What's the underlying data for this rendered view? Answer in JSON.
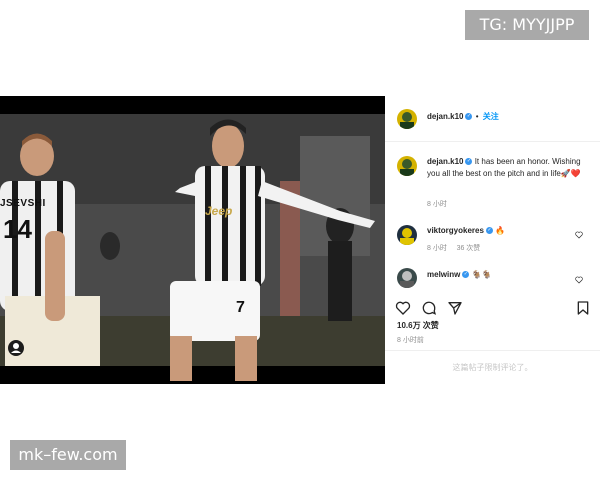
{
  "watermarks": {
    "top": "TG: MYYJJPP",
    "bottom": "mk–few.com"
  },
  "post": {
    "author": "dejan.k10",
    "follow_label": "关注",
    "separator": "•",
    "caption_user": "dejan.k10",
    "caption_text": "It has been an honor. Wishing you all the best on the pitch and in life🚀❤️",
    "caption_time": "8 小时",
    "likes": "10.6万 次赞",
    "timestamp": "8 小时前",
    "comments_closed": "这篇帖子限制评论了。"
  },
  "photo": {
    "left_jersey_name": "JSEVSHI",
    "left_jersey_number": "14",
    "right_jersey_sponsor": "Jeep",
    "right_shorts_number": "7"
  },
  "comments": [
    {
      "user": "viktorgyokeres",
      "text": "🔥",
      "time": "8 小时",
      "likes": "36 次赞"
    },
    {
      "user": "melwinw",
      "text": "🐐🐐",
      "time": "",
      "likes": ""
    }
  ],
  "icons": {
    "verified": "verified-badge-icon",
    "like": "heart-icon",
    "comment": "comment-bubble-icon",
    "share": "paper-plane-icon",
    "save": "bookmark-icon",
    "media_user": "user-tag-icon"
  },
  "colors": {
    "verified": "#3897f0",
    "follow": "#0095f6",
    "muted": "#8e8e8e",
    "watermark_bg": "#a9a9a9"
  }
}
